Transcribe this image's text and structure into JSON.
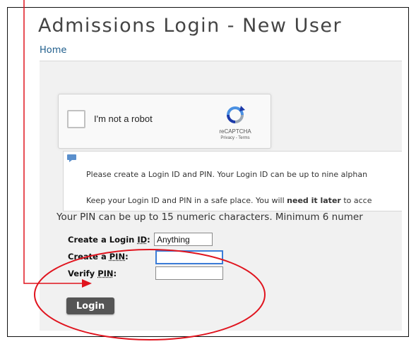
{
  "page": {
    "title": "Admissions Login - New User",
    "home_link": "Home"
  },
  "recaptcha": {
    "label": "I'm not a robot",
    "brand": "reCAPTCHA",
    "links": "Privacy - Terms"
  },
  "info": {
    "line1": "Please create a Login ID and PIN. Your Login ID can be up to nine alphan",
    "line2_pre": "Keep your Login ID and PIN in a safe place. You will ",
    "line2_bold": "need it later",
    "line2_post": " to acce"
  },
  "pin_note": "Your PIN can be up to 15 numeric characters. Minimum 6 numer",
  "form": {
    "login_id_label_pre": "Create a Login ",
    "login_id_label_u": "ID",
    "login_id_label_post": ":",
    "login_id_value": "Anything",
    "pin_label_pre": "Create a ",
    "pin_label_u": "PIN",
    "pin_label_post": ":",
    "pin_value": "",
    "verify_label_pre": "Verify ",
    "verify_label_u": "PIN",
    "verify_label_post": ":",
    "verify_value": "",
    "login_button": "Login"
  },
  "colors": {
    "annotation": "#e0141e",
    "link": "#1f5e8c",
    "button": "#555555"
  }
}
